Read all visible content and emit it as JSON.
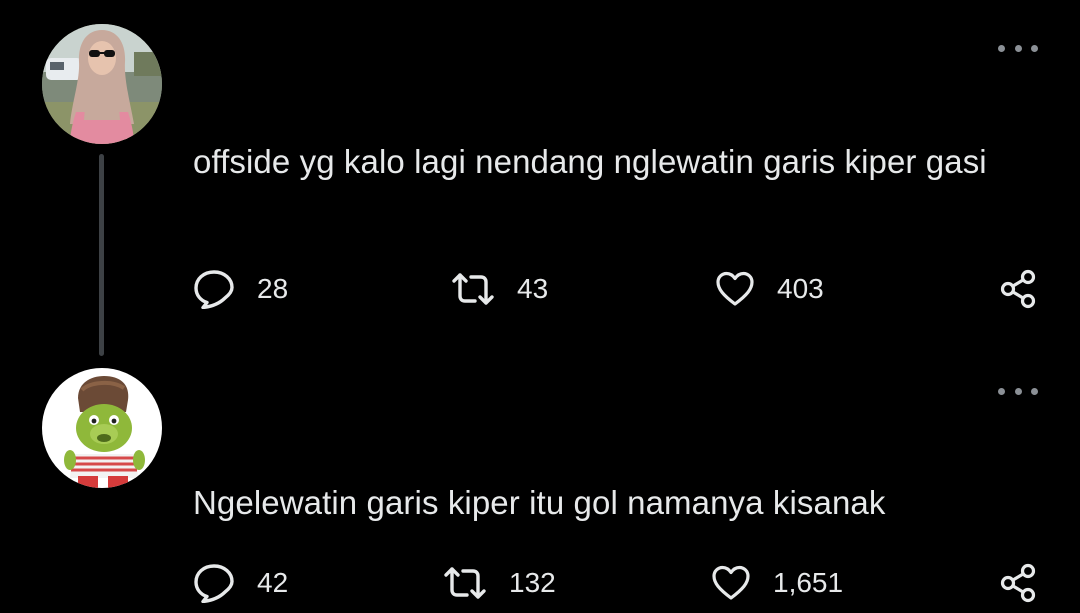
{
  "colors": {
    "background": "#000000",
    "text": "#e7e9ea",
    "icon": "#e7e9ea",
    "thread_line": "#3d4145",
    "more_dots": "#8b9096"
  },
  "tweets": [
    {
      "avatar_icon": "woman-hijab-photo-avatar",
      "text": "offside yg kalo lagi nendang nglewatin garis kiper gasi",
      "replies": "28",
      "retweets": "43",
      "likes": "403"
    },
    {
      "avatar_icon": "green-face-character-avatar",
      "text": "Ngelewatin garis kiper itu gol namanya kisanak",
      "replies": "42",
      "retweets": "132",
      "likes": "1,651"
    }
  ],
  "icons": {
    "reply": "speech-bubble-icon",
    "retweet": "retweet-arrows-icon",
    "like": "heart-icon",
    "share": "share-nodes-icon",
    "more": "more-dots-icon"
  }
}
